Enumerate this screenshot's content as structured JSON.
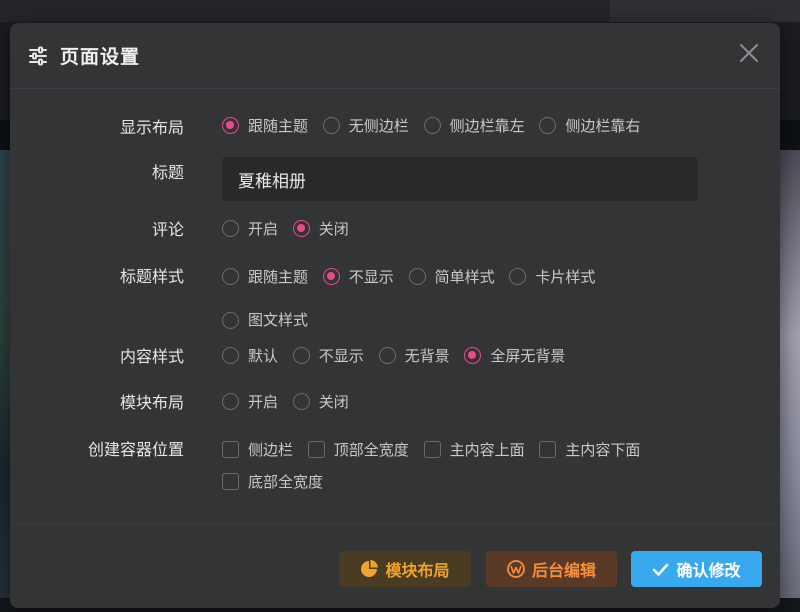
{
  "dialog": {
    "title": "页面设置",
    "title_icon": "sliders-icon",
    "close_icon": "close-icon"
  },
  "fields": {
    "layout": {
      "label": "显示布局",
      "options": [
        "跟随主题",
        "无侧边栏",
        "侧边栏靠左",
        "侧边栏靠右"
      ],
      "selected": "跟随主题"
    },
    "title": {
      "label": "标题",
      "value": "夏稚相册"
    },
    "comments": {
      "label": "评论",
      "options": [
        "开启",
        "关闭"
      ],
      "selected": "关闭"
    },
    "title_style": {
      "label": "标题样式",
      "options": [
        "跟随主题",
        "不显示",
        "简单样式",
        "卡片样式",
        "图文样式"
      ],
      "selected": "不显示"
    },
    "content_style": {
      "label": "内容样式",
      "options": [
        "默认",
        "不显示",
        "无背景",
        "全屏无背景"
      ],
      "selected": "全屏无背景"
    },
    "module_layout": {
      "label": "模块布局",
      "options": [
        "开启",
        "关闭"
      ],
      "selected": null
    },
    "container_position": {
      "label": "创建容器位置",
      "options": [
        "侧边栏",
        "顶部全宽度",
        "主内容上面",
        "主内容下面",
        "底部全宽度"
      ],
      "checked": []
    }
  },
  "footer": {
    "module_button": "模块布局",
    "admin_button": "后台编辑",
    "confirm_button": "确认修改"
  },
  "colors": {
    "accent_pink": "#e94a8c",
    "confirm_blue": "#38a9ef",
    "module_orange": "#f0a42a",
    "admin_orange": "#f58f3c",
    "dialog_bg": "#333436"
  }
}
